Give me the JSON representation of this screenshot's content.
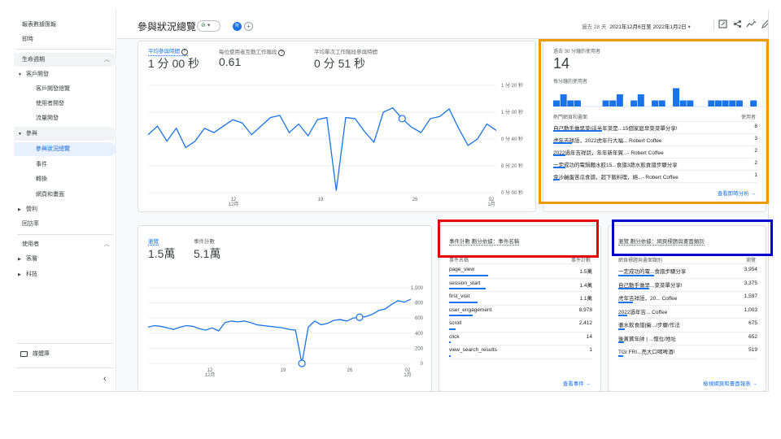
{
  "sidebar": {
    "top": [
      "報表數據匯報",
      "即時"
    ],
    "lifecycle_label": "生命週期",
    "acquisition": "客戶開發",
    "acquisition_items": [
      "客戶開發總覽",
      "使用者開發",
      "流量開發"
    ],
    "engagement": "參與",
    "engagement_items": [
      "參與狀況總覽",
      "事件",
      "轉換",
      "網頁和畫面"
    ],
    "monetization": "營利",
    "retention": "回訪率",
    "user_label": "使用者",
    "user_items": [
      "客層",
      "科技"
    ],
    "library": "媒體庫",
    "collapse_glyph": "‹"
  },
  "header": {
    "title": "參與狀況總覽",
    "status_glyph": "⊘",
    "avatar_letter": "所",
    "add_glyph": "+",
    "date_prefix": "過去 28 天",
    "date_range": "2021年12月6日至 2022年1月2日",
    "dropdown_glyph": "▾",
    "icons": [
      "edit-icon",
      "share-icon",
      "insights-icon",
      "pencil-icon"
    ]
  },
  "engagement_card": {
    "metrics": [
      {
        "label": "平均參與時間",
        "value": "1 分 00 秒"
      },
      {
        "label": "每位使用者互動工作階段",
        "value": "0.61"
      },
      {
        "label": "平均單次工作階段參與時間",
        "value": "0 分 51 秒"
      }
    ],
    "help_glyph": "?",
    "y_ticks": [
      "1 分 20 秒",
      "1 分 00 秒",
      "0 分 40 秒",
      "0 分 20 秒",
      "0 分 00 秒"
    ],
    "x_ticks": [
      "12\n12月",
      "19",
      "26",
      "02\n1月"
    ]
  },
  "realtime_card": {
    "label": "過去 30 分鐘的使用者",
    "value": "14",
    "per_minute_label": "每分鐘的使用者",
    "per_minute_bars": [
      1,
      2,
      1,
      1,
      0,
      0,
      0,
      1,
      1,
      2,
      0,
      1,
      2,
      0,
      1,
      1,
      0,
      3,
      1,
      1,
      0,
      0,
      1,
      1,
      1,
      1,
      1,
      0,
      1,
      0
    ],
    "table_header_left": "熱門網頁和畫面",
    "table_header_right": "使用者",
    "rows": [
      {
        "title": "自己動手做早菜|這半年菜是...15個家庭早菜菜單分享!",
        "value": "8"
      },
      {
        "title": "虎年吉祥語，2022虎年行大福... Robert Coffee",
        "value": "3"
      },
      {
        "title": "2022過年吉祥話，年年新年賀...- Robert Coffee",
        "value": "2"
      },
      {
        "title": "一定成功的電鍋麵水餃15...食譜3蔬水飲食譜步驟分享",
        "value": "2"
      },
      {
        "title": "金沙鹹蛋苦瓜食譜，超下飯料理，絕...- Robert Coffee",
        "value": "1"
      }
    ],
    "link": "查看即時分析"
  },
  "views_card": {
    "metrics": [
      {
        "label": "瀏覽",
        "value": "1.5萬"
      },
      {
        "label": "事件計數",
        "value": "5.1萬"
      }
    ],
    "y_ticks": [
      "1,000",
      "800",
      "600",
      "400",
      "200",
      "0"
    ],
    "x_ticks": [
      "12\n12月",
      "19",
      "26",
      "02\n1月"
    ]
  },
  "events_card": {
    "title": "事件計數 劃分依據：事件名稱",
    "col_left": "事件名稱",
    "col_right": "事件計數",
    "rows": [
      {
        "name": "page_view",
        "value": "1.5萬"
      },
      {
        "name": "session_start",
        "value": "1.4萬"
      },
      {
        "name": "first_visit",
        "value": "1.1萬"
      },
      {
        "name": "user_engagement",
        "value": "8,978"
      },
      {
        "name": "scroll",
        "value": "2,412"
      },
      {
        "name": "click",
        "value": "14"
      },
      {
        "name": "view_search_results",
        "value": "1"
      }
    ],
    "link": "查看事件"
  },
  "pages_card": {
    "title": "瀏覽 劃分依據：網頁標題與畫面類別",
    "col_left": "網頁標題與畫面類別",
    "col_right": "瀏覽",
    "rows": [
      {
        "name": "一定成功的電...食譜步驟分享",
        "value": "3,954"
      },
      {
        "name": "自己動手做早...菜菜單分享!",
        "value": "3,375"
      },
      {
        "name": "虎年吉祥語，20... Coffee",
        "value": "1,597"
      },
      {
        "name": "2022過年吉... Coffee",
        "value": "1,003"
      },
      {
        "name": "徹水飲食譜|衛.../步驟/作法",
        "value": "675"
      },
      {
        "name": "後黃寶年帥 | ...懷位/地址",
        "value": "652"
      },
      {
        "name": "TGI FRI...売大口喝啤酒!",
        "value": "519"
      }
    ],
    "link": "檢視網頁和畫面報表"
  },
  "colors": {
    "accent": "#1a73e8",
    "highlight_orange": "#f29900",
    "highlight_red": "#e60000",
    "highlight_blue": "#0000cc"
  }
}
